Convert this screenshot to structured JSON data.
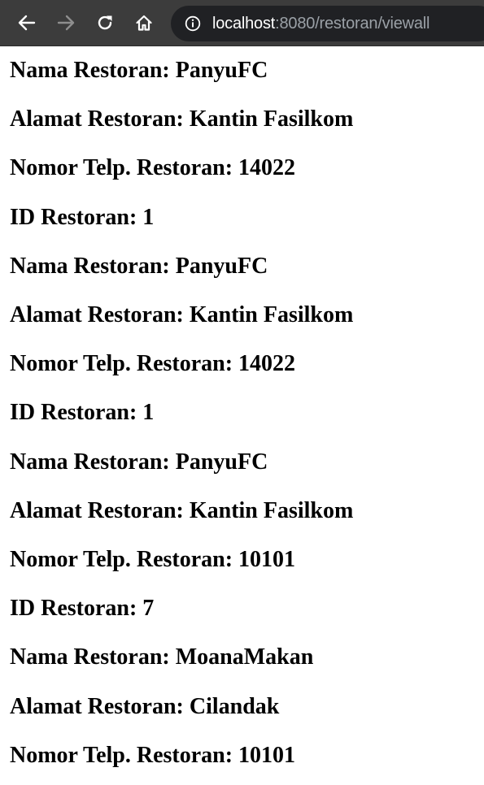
{
  "browser": {
    "url_host": "localhost",
    "url_path": ":8080/restoran/viewall",
    "icons": {
      "back": "arrow-left-icon",
      "forward": "arrow-right-icon",
      "reload": "reload-icon",
      "home": "home-icon",
      "info": "info-icon"
    },
    "colors": {
      "toolbar_bg": "#3c3c3c",
      "omnibox_bg": "#202124",
      "url_host": "#ffffff",
      "url_path": "#9aa0a6"
    }
  },
  "restaurants": [
    {
      "nama": "Nama Restoran: PanyuFC",
      "alamat": "Alamat Restoran: Kantin Fasilkom",
      "telp": "Nomor Telp. Restoran: 14022",
      "id": "ID Restoran: 1"
    },
    {
      "nama": "Nama Restoran: PanyuFC",
      "alamat": "Alamat Restoran: Kantin Fasilkom",
      "telp": "Nomor Telp. Restoran: 14022",
      "id": "ID Restoran: 1"
    },
    {
      "nama": "Nama Restoran: PanyuFC",
      "alamat": "Alamat Restoran: Kantin Fasilkom",
      "telp": "Nomor Telp. Restoran: 10101",
      "id": "ID Restoran: 7"
    },
    {
      "nama": "Nama Restoran: MoanaMakan",
      "alamat": "Alamat Restoran: Cilandak",
      "telp": "Nomor Telp. Restoran: 10101"
    }
  ]
}
